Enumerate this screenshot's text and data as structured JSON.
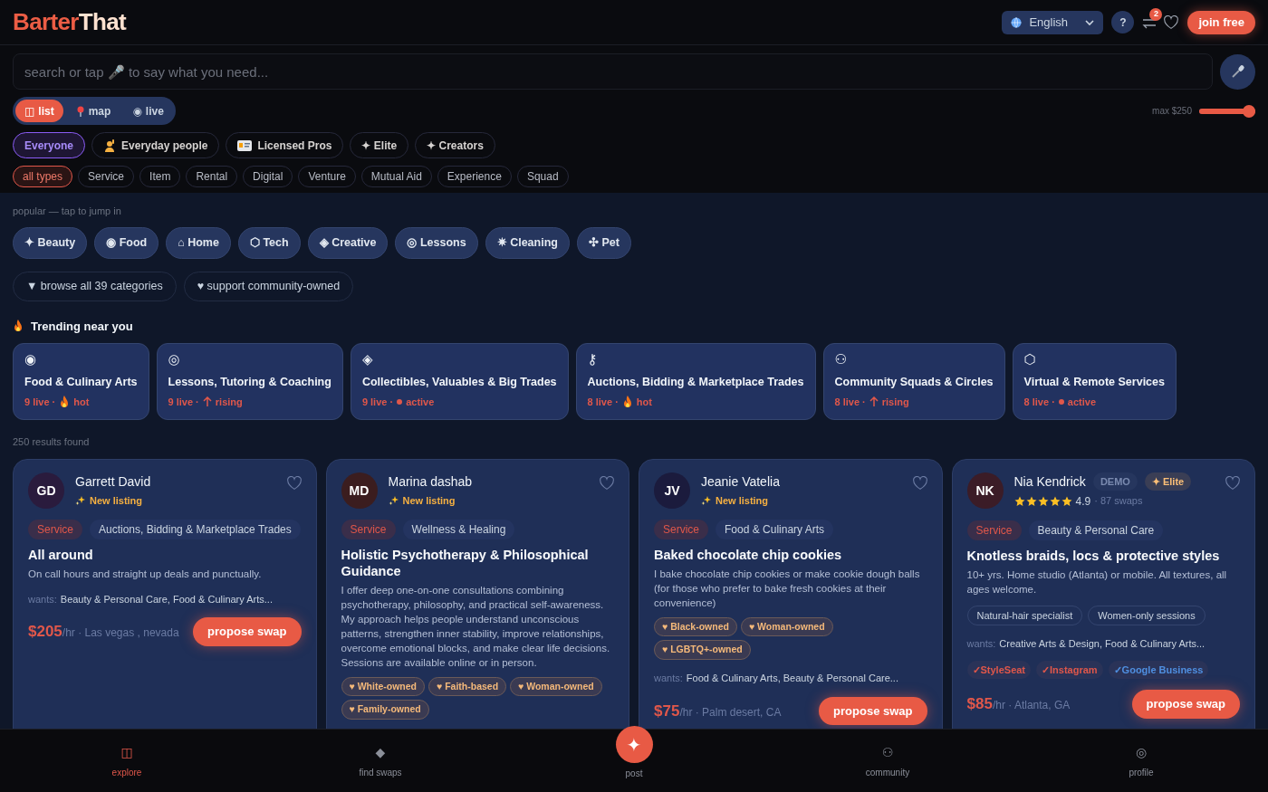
{
  "brand": {
    "first": "Barter",
    "second": "That"
  },
  "header": {
    "language": "English",
    "help": "?",
    "swap_count": "2",
    "join": "join free"
  },
  "search": {
    "placeholder": "search or tap 🎤 to say what you need..."
  },
  "view_tabs": [
    {
      "kind": "grid",
      "glyph": "◫",
      "label": "list",
      "selected": true
    },
    {
      "kind": "pin",
      "label": "map",
      "selected": false
    },
    {
      "kind": "dot",
      "glyph": "◉",
      "label": "live",
      "selected": false
    }
  ],
  "price_filter": {
    "label": "max $250",
    "level": 1
  },
  "audience": [
    {
      "kind": "none",
      "label": "Everyone",
      "selected": true
    },
    {
      "kind": "person",
      "label": "Everyday people",
      "selected": false
    },
    {
      "kind": "card",
      "label": "Licensed Pros",
      "selected": false
    },
    {
      "kind": "none",
      "label": "✦ Elite",
      "selected": false
    },
    {
      "kind": "none",
      "label": "✦ Creators",
      "selected": false
    }
  ],
  "types": [
    {
      "label": "all types",
      "selected": true
    },
    {
      "label": "Service",
      "selected": false
    },
    {
      "label": "Item",
      "selected": false
    },
    {
      "label": "Rental",
      "selected": false
    },
    {
      "label": "Digital",
      "selected": false
    },
    {
      "label": "Venture",
      "selected": false
    },
    {
      "label": "Mutual Aid",
      "selected": false
    },
    {
      "label": "Experience",
      "selected": false
    },
    {
      "label": "Squad",
      "selected": false
    }
  ],
  "popular": {
    "caption": "popular — tap to jump in",
    "chips": [
      "✦ Beauty",
      "◉ Food",
      "⌂ Home",
      "⬡ Tech",
      "◈ Creative",
      "◎ Lessons",
      "✷ Cleaning",
      "✣ Pet"
    ],
    "links": [
      "▼ browse all 39 categories",
      "♥ support community-owned"
    ]
  },
  "trending": {
    "title": "Trending near you",
    "cards": [
      {
        "icon": "◉",
        "title": "Food & Culinary Arts",
        "live": "9 live ·",
        "trend": {
          "kind": "hot",
          "label": "hot"
        }
      },
      {
        "icon": "◎",
        "title": "Lessons, Tutoring & Coaching",
        "live": "9 live ·",
        "trend": {
          "kind": "rising",
          "label": "rising"
        }
      },
      {
        "icon": "◈",
        "title": "Collectibles, Valuables & Big Trades",
        "live": "9 live ·",
        "trend": {
          "kind": "active",
          "label": "active"
        }
      },
      {
        "icon": "⚷",
        "title": "Auctions, Bidding & Marketplace Trades",
        "live": "8 live ·",
        "trend": {
          "kind": "hot",
          "label": "hot"
        }
      },
      {
        "icon": "⚇",
        "title": "Community Squads & Circles",
        "live": "8 live ·",
        "trend": {
          "kind": "rising",
          "label": "rising"
        }
      },
      {
        "icon": "⬡",
        "title": "Virtual & Remote Services",
        "live": "8 live ·",
        "trend": {
          "kind": "active",
          "label": "active"
        }
      }
    ]
  },
  "results_count": "250 results found",
  "listings": [
    {
      "initials": "GD",
      "color": "#2a1b3d",
      "name": "Garrett David",
      "new_label": "New listing",
      "type": "Service",
      "category": "Auctions, Bidding & Marketplace Trades",
      "title": "All around",
      "description": "On call hours and straight up deals and punctually.",
      "wants_label": "wants:",
      "wants": "Beauty & Personal Care, Food & Culinary Arts...",
      "price": "$205",
      "unit": "/hr · Las vegas , nevada",
      "action": "propose swap"
    },
    {
      "initials": "MD",
      "color": "#3b1d1f",
      "name": "Marina dashab",
      "new_label": "New listing",
      "type": "Service",
      "category": "Wellness & Healing",
      "title": "Holistic Psychotherapy & Philosophical Guidance",
      "description": "I offer deep one-on-one consultations combining psychotherapy, philosophy, and practical self-awareness. My approach helps people understand unconscious patterns, strengthen inner stability, improve relationships, overcome emotional blocks, and make clear life decisions. Sessions are available online or in person.",
      "owned": [
        "♥ White-owned",
        "♥ Faith-based",
        "♥ Woman-owned",
        "♥ Family-owned"
      ]
    },
    {
      "initials": "JV",
      "color": "#1b1b3d",
      "name": "Jeanie Vatelia",
      "new_label": "New listing",
      "type": "Service",
      "category": "Food & Culinary Arts",
      "title": "Baked chocolate chip cookies",
      "description": "I bake chocolate chip cookies or make cookie dough balls (for those who prefer to bake fresh cookies at their convenience)",
      "owned": [
        "♥ Black-owned",
        "♥ Woman-owned",
        "♥ LGBTQ+-owned"
      ],
      "wants_label": "wants:",
      "wants": "Food & Culinary Arts, Beauty & Personal Care...",
      "price": "$75",
      "unit": "/hr · Palm desert, CA",
      "action": "propose swap"
    },
    {
      "initials": "NK",
      "color": "#3b1c27",
      "name": "Nia Kendrick",
      "demo": "DEMO",
      "elite": "✦ Elite",
      "stars": 5,
      "rating": "4.9",
      "swaps": "· 87 swaps",
      "type": "Service",
      "category": "Beauty & Personal Care",
      "title": "Knotless braids, locs & protective styles",
      "description": "10+ yrs. Home studio (Atlanta) or mobile. All textures, all ages welcome.",
      "specialties": [
        "Natural-hair specialist",
        "Women-only sessions"
      ],
      "wants_label": "wants:",
      "wants": "Creative Arts & Design, Food & Culinary Arts...",
      "verified": [
        {
          "label": "✓StyleSeat",
          "color": "#e0574a"
        },
        {
          "label": "✓Instagram",
          "color": "#e0574a"
        },
        {
          "label": "✓Google Business",
          "color": "#4f8fe0"
        }
      ],
      "price": "$85",
      "unit": "/hr · Atlanta, GA",
      "action": "propose swap"
    }
  ],
  "nav": [
    {
      "glyph": "◫",
      "label": "explore",
      "selected": true
    },
    {
      "glyph": "◆",
      "label": "find swaps",
      "selected": false
    },
    {
      "glyph": "✦",
      "label": "post",
      "kind": "primary",
      "selected": false
    },
    {
      "glyph": "⚇",
      "label": "community",
      "selected": false
    },
    {
      "glyph": "◎",
      "label": "profile",
      "selected": false
    }
  ]
}
